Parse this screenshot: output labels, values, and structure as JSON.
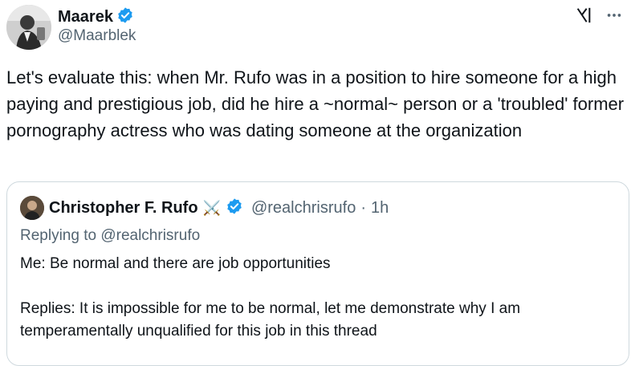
{
  "post": {
    "author": {
      "display_name": "Maarek",
      "handle": "@Maarblek",
      "verified": true
    },
    "text": "Let's evaluate this: when Mr. Rufo was in a position to hire someone for a high paying and prestigious job, did he hire a ~normal~ person or a 'troubled' former pornography actress who was dating someone at the organization",
    "icons": {
      "grok": "grok-icon",
      "more": "more-icon",
      "verified": "verified-badge-icon"
    }
  },
  "quoted": {
    "author": {
      "display_name": "Christopher F. Rufo",
      "emoji": "⚔️",
      "handle": "@realchrisrufo",
      "verified": true
    },
    "separator": "·",
    "time": "1h",
    "replying_to": "Replying to @realchrisrufo",
    "text_line1": "Me: Be normal and there are job opportunities",
    "text_line2": "Replies: It is impossible for me to be normal, let me demonstrate why I am temperamentally unqualified for this job in this thread"
  },
  "colors": {
    "accent": "#1d9bf0",
    "secondary_text": "#536471",
    "border": "#cfd9de"
  }
}
